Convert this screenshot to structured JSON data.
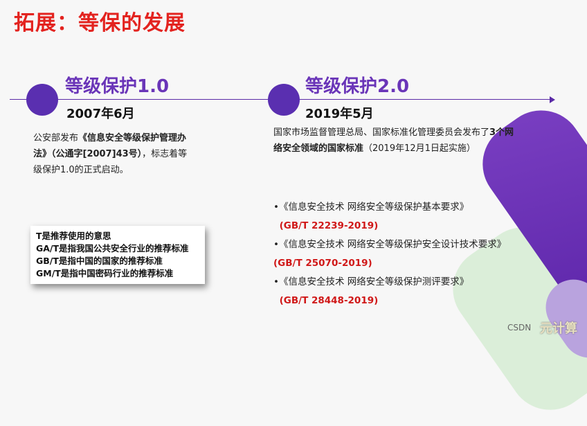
{
  "title": "拓展：等保的发展",
  "left": {
    "level": "等级保护1.0",
    "date": "2007年6月",
    "desc_pre": "公安部发布",
    "desc_bold": "《信息安全等级保护管理办法》（公通字[2007]43号）",
    "desc_post": "，标志着等级保护1.0的正式启动。"
  },
  "right": {
    "level": "等级保护2.0",
    "date": "2019年5月",
    "desc_pre": "国家市场监督管理总局、国家标准化管理委员会发布了",
    "desc_bold": "3个网络安全领域的国家标准",
    "desc_post": "（2019年12月1日起实施）",
    "standards": [
      {
        "name": "•《信息安全技术  网络安全等级保护基本要求》",
        "code": "(GB/T 22239-2019)"
      },
      {
        "name": "•《信息安全技术  网络安全等级保护安全设计技术要求》",
        "code": "(GB/T 25070-2019)"
      },
      {
        "name": "•《信息安全技术  网络安全等级保护测评要求》",
        "code": "(GB/T 28448-2019)"
      }
    ]
  },
  "legend": [
    "T是推荐使用的意思",
    "GA/T是指我国公共安全行业的推荐标准",
    "GB/T是指中国的国家的推荐标准",
    "GM/T是指中国密码行业的推荐标准"
  ],
  "watermark": "CSDN",
  "watermark_brand": "元计算",
  "colors": {
    "title": "#e3231f",
    "accent": "#6a35b8",
    "code": "#d01818"
  }
}
